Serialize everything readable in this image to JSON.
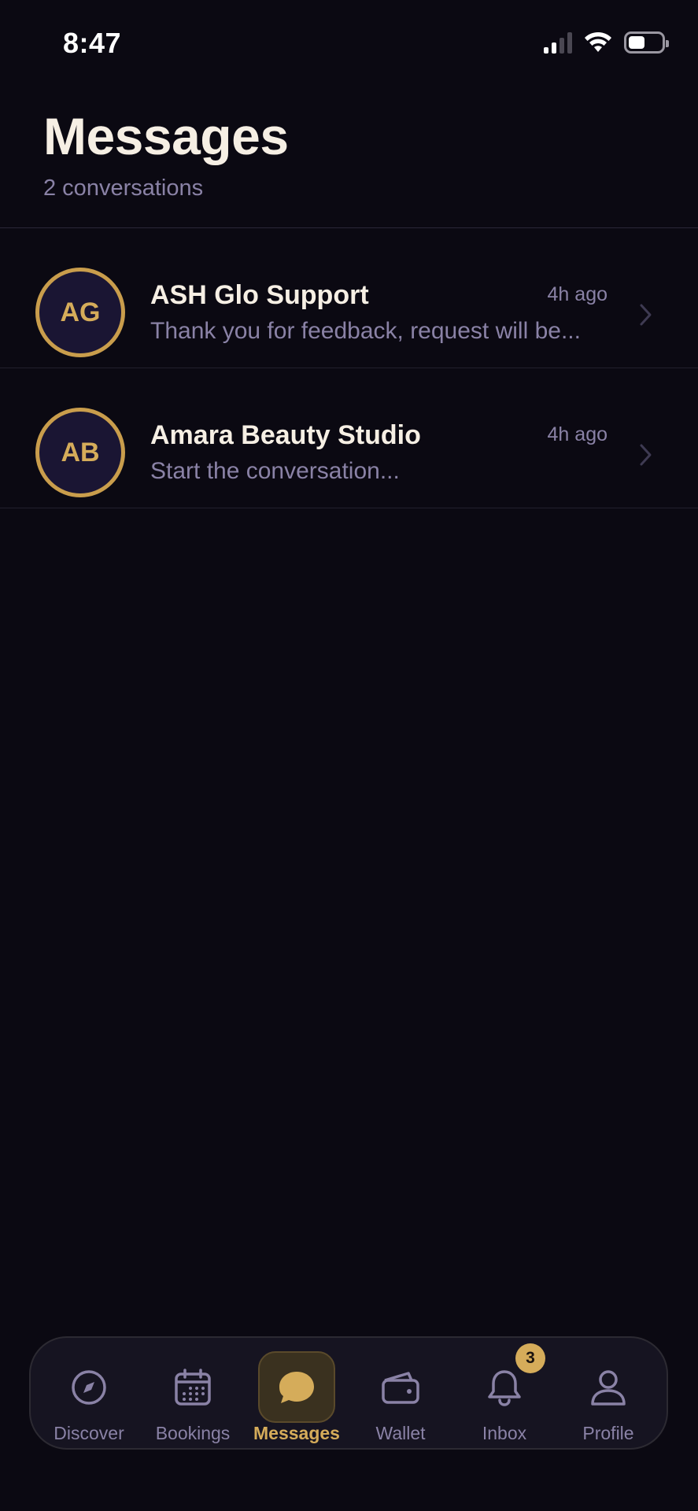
{
  "status": {
    "time": "8:47"
  },
  "header": {
    "title": "Messages",
    "subtitle": "2 conversations"
  },
  "conversations": [
    {
      "initials": "AG",
      "name": "ASH Glo Support",
      "time": "4h ago",
      "preview": "Thank you for feedback, request will be..."
    },
    {
      "initials": "AB",
      "name": "Amara Beauty Studio",
      "time": "4h ago",
      "preview": "Start the conversation..."
    }
  ],
  "tabs": [
    {
      "label": "Discover",
      "icon": "compass-icon"
    },
    {
      "label": "Bookings",
      "icon": "calendar-icon"
    },
    {
      "label": "Messages",
      "icon": "chat-bubble-icon",
      "active": true
    },
    {
      "label": "Wallet",
      "icon": "wallet-icon"
    },
    {
      "label": "Inbox",
      "icon": "bell-icon",
      "badge": "3"
    },
    {
      "label": "Profile",
      "icon": "person-icon"
    }
  ],
  "colors": {
    "background": "#0b0912",
    "accent": "#d5ac5a",
    "muted": "#8a82a6",
    "text": "#f6efe4"
  }
}
